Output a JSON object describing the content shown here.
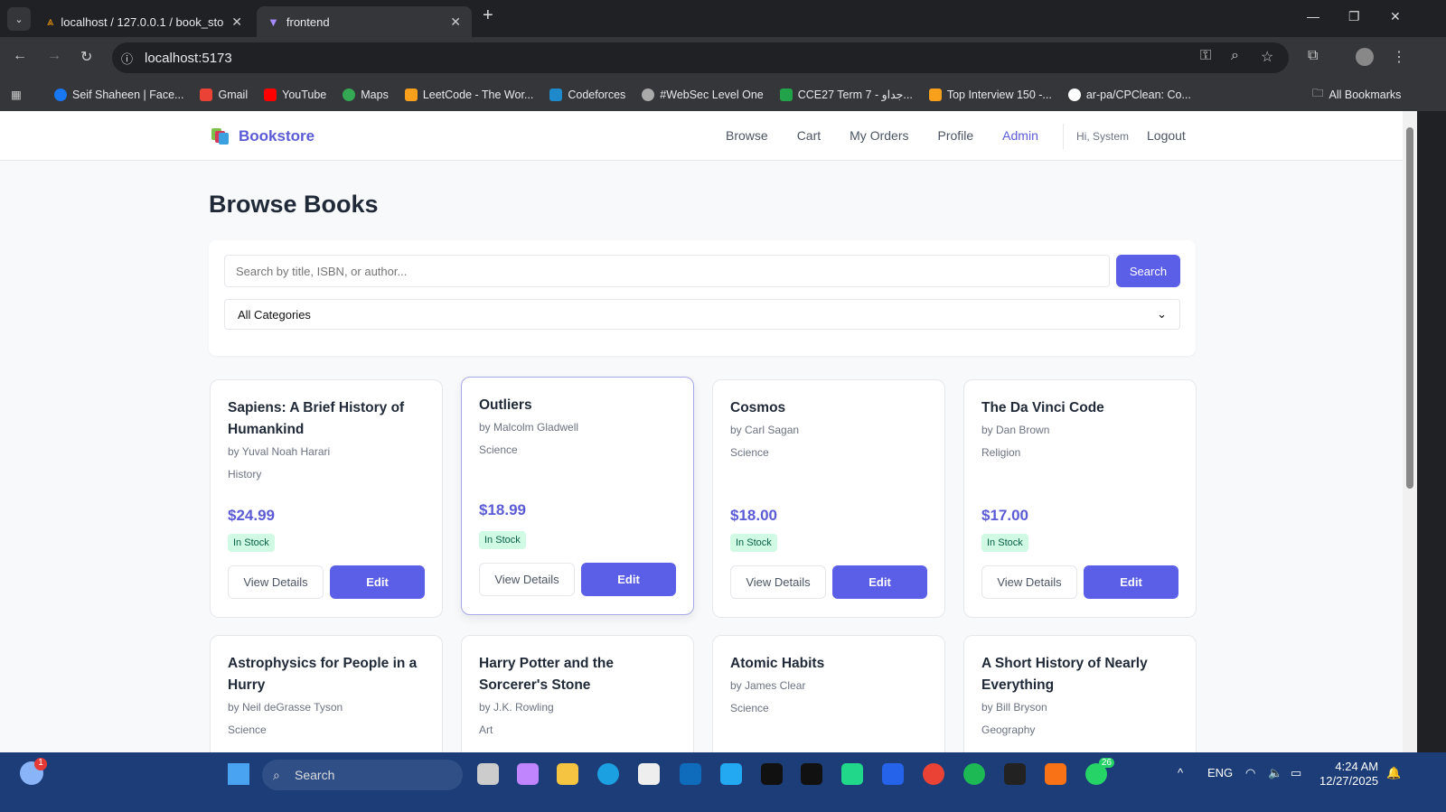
{
  "browser": {
    "tabs": [
      {
        "title": "localhost / 127.0.0.1 / book_sto",
        "active": false
      },
      {
        "title": "frontend",
        "active": true
      }
    ],
    "url": "localhost:5173",
    "bookmarks": [
      "Seif Shaheen | Face...",
      "Gmail",
      "YouTube",
      "Maps",
      "LeetCode - The Wor...",
      "Codeforces",
      "#WebSec Level One",
      "CCE27 Term 7 - جداو...",
      "Top Interview 150 -...",
      "ar-pa/CPClean: Co..."
    ],
    "all_bookmarks": "All Bookmarks"
  },
  "nav": {
    "brand": "Bookstore",
    "links": [
      "Browse",
      "Cart",
      "My Orders",
      "Profile",
      "Admin"
    ],
    "greeting": "Hi, System",
    "logout": "Logout",
    "accent": "#5b5bd6"
  },
  "main": {
    "title": "Browse Books",
    "search_placeholder": "Search by title, ISBN, or author...",
    "search_button": "Search",
    "category_selected": "All Categories",
    "view_label": "View Details",
    "edit_label": "Edit",
    "books": [
      {
        "title": "Sapiens: A Brief History of Humankind",
        "author": "by Yuval Noah Harari",
        "category": "History",
        "price": "$24.99",
        "stock": "In Stock"
      },
      {
        "title": "Outliers",
        "author": "by Malcolm Gladwell",
        "category": "Science",
        "price": "$18.99",
        "stock": "In Stock"
      },
      {
        "title": "Cosmos",
        "author": "by Carl Sagan",
        "category": "Science",
        "price": "$18.00",
        "stock": "In Stock"
      },
      {
        "title": "The Da Vinci Code",
        "author": "by Dan Brown",
        "category": "Religion",
        "price": "$17.00",
        "stock": "In Stock"
      },
      {
        "title": "Astrophysics for People in a Hurry",
        "author": "by Neil deGrasse Tyson",
        "category": "Science"
      },
      {
        "title": "Harry Potter and the Sorcerer's Stone",
        "author": "by J.K. Rowling",
        "category": "Art"
      },
      {
        "title": "Atomic Habits",
        "author": "by James Clear",
        "category": "Science"
      },
      {
        "title": "A Short History of Nearly Everything",
        "author": "by Bill Bryson",
        "category": "Geography"
      }
    ]
  },
  "taskbar": {
    "search": "Search",
    "lang": "ENG",
    "time": "4:24 AM",
    "date": "12/27/2025",
    "weather_badge": "1",
    "whatsapp_badge": "26"
  }
}
